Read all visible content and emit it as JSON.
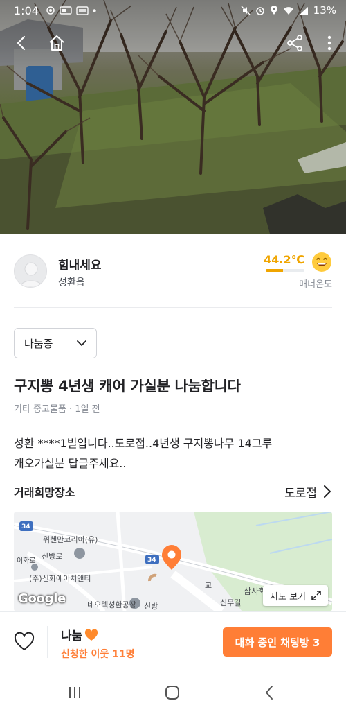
{
  "status_bar": {
    "time": "1:04",
    "battery": "13%"
  },
  "icons": {
    "back": "chevron-left-icon",
    "home": "home-icon",
    "share": "share-icon",
    "more": "more-vertical-icon",
    "heart": "heart-outline-icon",
    "map_expand": "expand-icon"
  },
  "seller": {
    "name": "힘내세요",
    "location": "성환읍",
    "temperature": "44.2℃",
    "temperature_level": 0.44,
    "manner_label": "매너온도"
  },
  "article": {
    "status_select": "나눔중",
    "title": "구지뽕 4년생 캐어 가실분 나눔합니다",
    "category": "기타 중고물품",
    "time_ago": "· 1일 전",
    "description_line1": "성환      ****1빌입니다..도로접..4년생 구지뽕나무 14그루",
    "description_line2": "캐오가실분 답글주세요.."
  },
  "trade": {
    "label": "거래희망장소",
    "value": "도로접"
  },
  "map": {
    "view_button": "지도 보기",
    "labels": [
      "위첸만코리아(유)",
      "신방로",
      "이화로",
      "(주)신화에이치앤티",
      "네오텍성환공장",
      "신무길",
      "삼사화",
      "교",
      "신방",
      "34",
      "34",
      "Google"
    ]
  },
  "bottom_bar": {
    "share_label": "나눔",
    "applicants": "신청한 이웃 11명",
    "chat_button": "대화 중인 채팅방 3"
  },
  "colors": {
    "brand_orange": "#ff7e36",
    "temperature_yellow": "#f0a500"
  }
}
